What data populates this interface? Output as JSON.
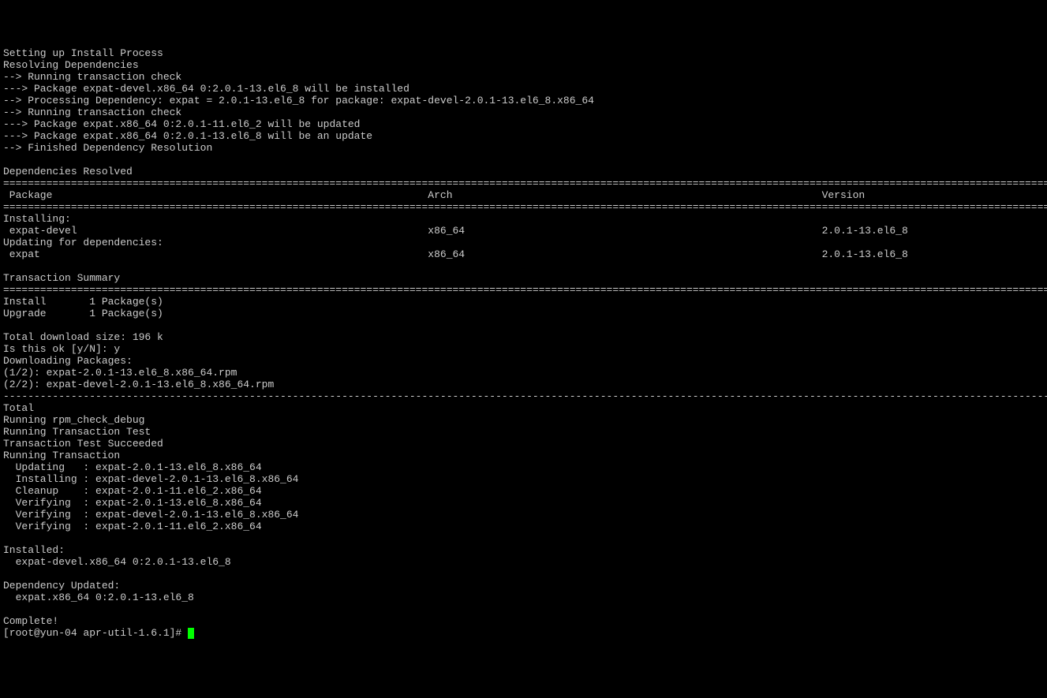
{
  "header_lines": [
    "Setting up Install Process",
    "Resolving Dependencies",
    "--> Running transaction check",
    "---> Package expat-devel.x86_64 0:2.0.1-13.el6_8 will be installed",
    "--> Processing Dependency: expat = 2.0.1-13.el6_8 for package: expat-devel-2.0.1-13.el6_8.x86_64",
    "--> Running transaction check",
    "---> Package expat.x86_64 0:2.0.1-11.el6_2 will be updated",
    "---> Package expat.x86_64 0:2.0.1-13.el6_8 will be an update",
    "--> Finished Dependency Resolution",
    "",
    "Dependencies Resolved",
    ""
  ],
  "table": {
    "headers": {
      "c0": " Package",
      "c1": "Arch",
      "c2": "Version"
    },
    "section_installing": "Installing:",
    "row1": {
      "c0": " expat-devel",
      "c1": "x86_64",
      "c2": "2.0.1-13.el6_8"
    },
    "section_updating": "Updating for dependencies:",
    "row2": {
      "c0": " expat",
      "c1": "x86_64",
      "c2": "2.0.1-13.el6_8"
    }
  },
  "summary_title": "Transaction Summary",
  "summary_lines": [
    "Install       1 Package(s)",
    "Upgrade       1 Package(s)",
    "",
    "Total download size: 196 k",
    "Is this ok [y/N]: y",
    "Downloading Packages:",
    "(1/2): expat-2.0.1-13.el6_8.x86_64.rpm",
    "(2/2): expat-devel-2.0.1-13.el6_8.x86_64.rpm"
  ],
  "post_lines": [
    "Total",
    "Running rpm_check_debug",
    "Running Transaction Test",
    "Transaction Test Succeeded",
    "Running Transaction",
    "  Updating   : expat-2.0.1-13.el6_8.x86_64",
    "  Installing : expat-devel-2.0.1-13.el6_8.x86_64",
    "  Cleanup    : expat-2.0.1-11.el6_2.x86_64",
    "  Verifying  : expat-2.0.1-13.el6_8.x86_64",
    "  Verifying  : expat-devel-2.0.1-13.el6_8.x86_64",
    "  Verifying  : expat-2.0.1-11.el6_2.x86_64",
    "",
    "Installed:",
    "  expat-devel.x86_64 0:2.0.1-13.el6_8",
    "",
    "Dependency Updated:",
    "  expat.x86_64 0:2.0.1-13.el6_8",
    "",
    "Complete!"
  ],
  "prompt": "[root@yun-04 apr-util-1.6.1]# "
}
